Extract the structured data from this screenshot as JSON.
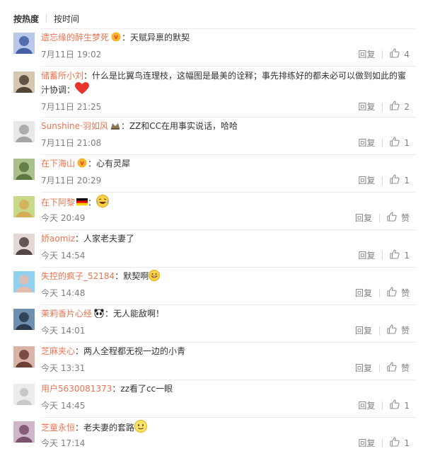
{
  "sort": {
    "hot": "按热度",
    "time": "按时间"
  },
  "reply_label": "回复",
  "like_placeholder": "赞",
  "comments": [
    {
      "user": "遗忘缘的醉生梦死",
      "badge": "vip-badge",
      "text": "：天赋异禀的默契",
      "time": "7月11日 19:02",
      "likes": "4"
    },
    {
      "user": "储蓄所小刘",
      "badge": "",
      "text": "：什么是比翼鸟连理枝，这幅图是最美的诠释；事先排练好的都未必可以做到如此的蜜汁协调：",
      "emoji": "heart",
      "time": "7月11日 21:25",
      "likes": "2"
    },
    {
      "user": "Sunshine·羽如风",
      "badge": "member-badge",
      "text": "：ZZ和CC在用事实说话，哈哈",
      "time": "7月11日 21:08",
      "likes": "1"
    },
    {
      "user": "在下海山",
      "badge": "vip-badge",
      "text": "：心有灵犀",
      "time": "7月11日 20:29",
      "likes": "1"
    },
    {
      "user": "在下阿黎",
      "badge": "germany-flag",
      "text": "：",
      "emoji": "laugh",
      "time": "今天 20:49",
      "likes": "赞"
    },
    {
      "user": "娇aomiz",
      "badge": "",
      "text": "：人家老夫妻了",
      "time": "今天 14:54",
      "likes": "1"
    },
    {
      "user": "失控的疯子_52184",
      "badge": "",
      "text": "：默契啊",
      "emoji": "grin",
      "time": "今天 14:48",
      "likes": "赞"
    },
    {
      "user": "茉莉香片心经",
      "badge": "panda-badge",
      "text": "：无人能敌啊！",
      "time": "今天 14:01",
      "likes": "赞"
    },
    {
      "user": "芝麻夹心",
      "badge": "",
      "text": "：两人全程都无视一边的小青",
      "time": "今天 13:31",
      "likes": "赞"
    },
    {
      "user": "用户5630081373",
      "badge": "",
      "text": "：zz看了cc一眼",
      "time": "今天 14:45",
      "likes": "1"
    },
    {
      "user": "芝童永恒",
      "badge": "",
      "text": "：老夫妻的套路",
      "emoji": "smile",
      "time": "今天 17:14",
      "likes": "1"
    }
  ],
  "colors": {
    "username": "#eb7350",
    "meta": "#808080",
    "text": "#333333"
  }
}
